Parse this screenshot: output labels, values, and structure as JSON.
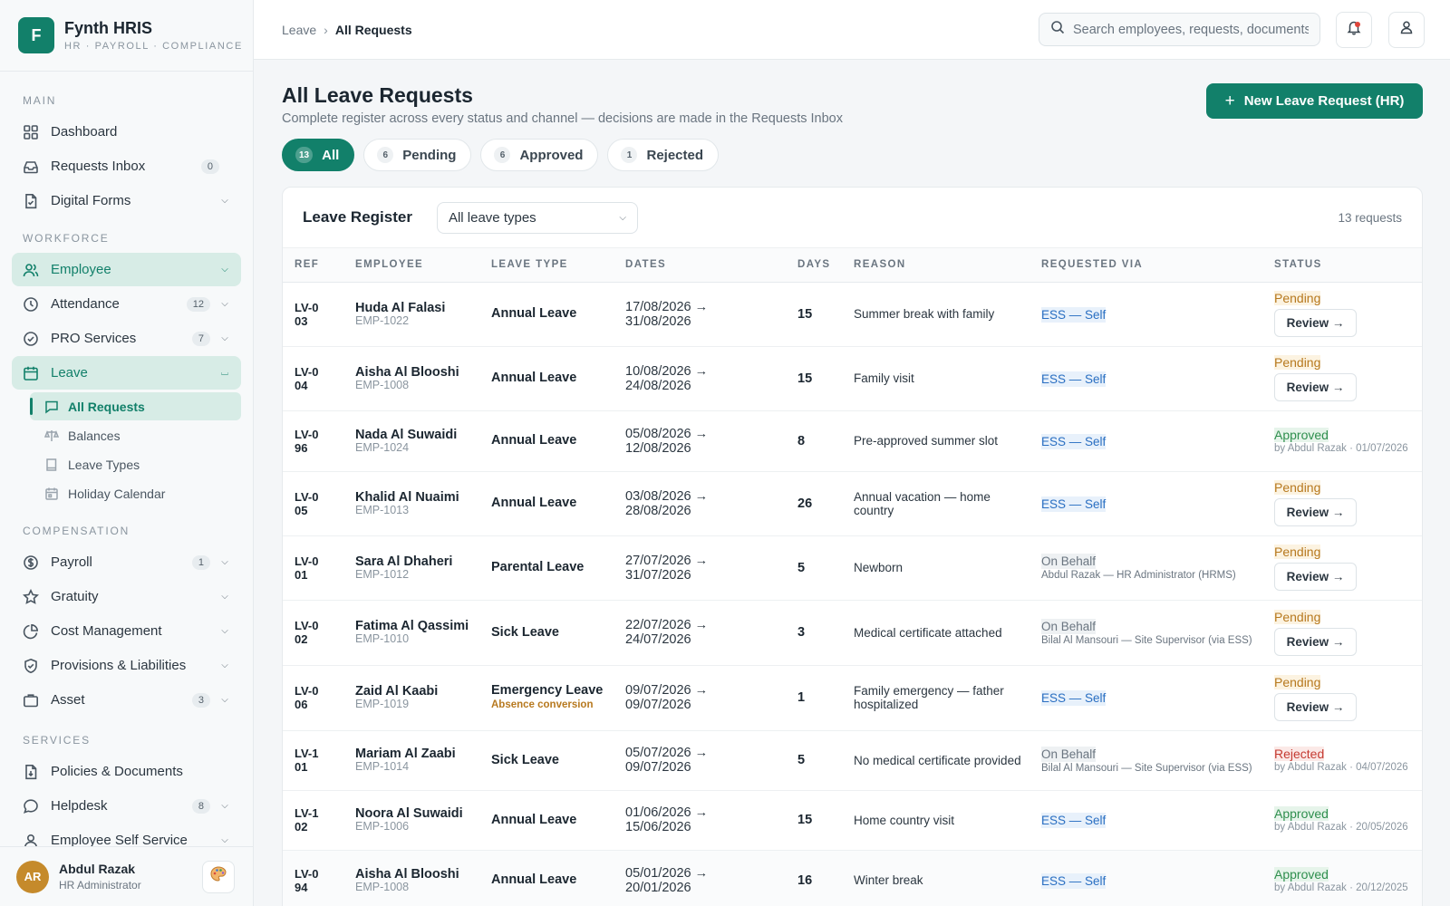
{
  "brand": {
    "logo_letter": "F",
    "name": "Fynth HRIS",
    "subtitle": "HR · PAYROLL · COMPLIANCE",
    "color": "#12806a"
  },
  "sidebar": {
    "sections": {
      "main": "MAIN",
      "workforce": "WORKFORCE",
      "compensation": "COMPENSATION",
      "services": "SERVICES"
    },
    "main_items": [
      {
        "label": "Dashboard",
        "icon": "grid-icon"
      },
      {
        "label": "Requests Inbox",
        "icon": "inbox-icon",
        "badge": "0"
      },
      {
        "label": "Digital Forms",
        "icon": "form-icon"
      }
    ],
    "workforce_items": [
      {
        "label": "Employee",
        "icon": "users-icon",
        "active": true
      },
      {
        "label": "Attendance",
        "icon": "clock-icon",
        "badge": "12"
      },
      {
        "label": "PRO Services",
        "icon": "check-circle-icon",
        "badge": "7"
      },
      {
        "label": "Leave",
        "icon": "calendar-icon",
        "active": true,
        "expanded": true
      }
    ],
    "leave_sub_items": [
      {
        "label": "All Requests",
        "icon": "message-icon",
        "active": true
      },
      {
        "label": "Balances",
        "icon": "scale-icon"
      },
      {
        "label": "Leave Types",
        "icon": "book-icon"
      },
      {
        "label": "Holiday Calendar",
        "icon": "calendar-small-icon"
      }
    ],
    "compensation_items": [
      {
        "label": "Payroll",
        "icon": "dollar-icon",
        "badge": "1"
      },
      {
        "label": "Gratuity",
        "icon": "star-icon"
      },
      {
        "label": "Cost Management",
        "icon": "pie-icon"
      },
      {
        "label": "Provisions & Liabilities",
        "icon": "shield-icon"
      },
      {
        "label": "Asset",
        "icon": "briefcase-icon",
        "badge": "3"
      }
    ],
    "services_items": [
      {
        "label": "Policies & Documents",
        "icon": "document-icon"
      },
      {
        "label": "Helpdesk",
        "icon": "chat-icon",
        "badge": "8"
      },
      {
        "label": "Employee Self Service",
        "icon": "user-icon"
      }
    ]
  },
  "user": {
    "initials": "AR",
    "name": "Abdul Razak",
    "role": "HR Administrator",
    "avatar_color": "#c58a2b"
  },
  "topbar": {
    "breadcrumb": [
      "Leave",
      "All Requests"
    ],
    "search_placeholder": "Search employees, requests, documents..."
  },
  "page": {
    "title": "All Leave Requests",
    "subtitle": "Complete register across every status and channel — decisions are made in the Requests Inbox",
    "new_button": "New Leave Request (HR)"
  },
  "tabs": [
    {
      "count": "13",
      "label": "All",
      "active": true
    },
    {
      "count": "6",
      "label": "Pending"
    },
    {
      "count": "6",
      "label": "Approved"
    },
    {
      "count": "1",
      "label": "Rejected"
    }
  ],
  "register": {
    "title": "Leave Register",
    "filter_value": "All leave types",
    "count_text": "13 requests",
    "columns": [
      "REF",
      "EMPLOYEE",
      "LEAVE TYPE",
      "DATES",
      "DAYS",
      "REASON",
      "REQUESTED VIA",
      "STATUS"
    ],
    "review_label": "Review →",
    "rows": [
      {
        "ref": "LV-003",
        "name": "Huda Al Falasi",
        "emp_id": "EMP-1022",
        "type": "Annual Leave",
        "dates": "17/08/2026 → 31/08/2026",
        "days": "15",
        "reason": "Summer break with family",
        "via": "ESS — Self",
        "via_kind": "self",
        "status": "Pending",
        "status_kind": "pending"
      },
      {
        "ref": "LV-004",
        "name": "Aisha Al Blooshi",
        "emp_id": "EMP-1008",
        "type": "Annual Leave",
        "dates": "10/08/2026 → 24/08/2026",
        "days": "15",
        "reason": "Family visit",
        "via": "ESS — Self",
        "via_kind": "self",
        "status": "Pending",
        "status_kind": "pending"
      },
      {
        "ref": "LV-096",
        "name": "Nada Al Suwaidi",
        "emp_id": "EMP-1024",
        "type": "Annual Leave",
        "dates": "05/08/2026 → 12/08/2026",
        "days": "8",
        "reason": "Pre-approved summer slot",
        "via": "ESS — Self",
        "via_kind": "self",
        "status": "Approved",
        "status_kind": "approved",
        "status_note": "by Abdul Razak · 01/07/2026"
      },
      {
        "ref": "LV-005",
        "name": "Khalid Al Nuaimi",
        "emp_id": "EMP-1013",
        "type": "Annual Leave",
        "dates": "03/08/2026 → 28/08/2026",
        "days": "26",
        "reason": "Annual vacation — home country",
        "via": "ESS — Self",
        "via_kind": "self",
        "status": "Pending",
        "status_kind": "pending"
      },
      {
        "ref": "LV-001",
        "name": "Sara Al Dhaheri",
        "emp_id": "EMP-1012",
        "type": "Parental Leave",
        "dates": "27/07/2026 → 31/07/2026",
        "days": "5",
        "reason": "Newborn",
        "via": "On Behalf",
        "via_kind": "behalf",
        "via_note": "Abdul Razak — HR Administrator (HRMS)",
        "status": "Pending",
        "status_kind": "pending"
      },
      {
        "ref": "LV-002",
        "name": "Fatima Al Qassimi",
        "emp_id": "EMP-1010",
        "type": "Sick Leave",
        "dates": "22/07/2026 → 24/07/2026",
        "days": "3",
        "reason": "Medical certificate attached",
        "via": "On Behalf",
        "via_kind": "behalf",
        "via_note": "Bilal Al Mansouri — Site Supervisor (via ESS)",
        "status": "Pending",
        "status_kind": "pending"
      },
      {
        "ref": "LV-006",
        "name": "Zaid Al Kaabi",
        "emp_id": "EMP-1019",
        "type": "Emergency Leave",
        "type_note": "Absence conversion",
        "dates": "09/07/2026 → 09/07/2026",
        "days": "1",
        "reason": "Family emergency — father hospitalized",
        "via": "ESS — Self",
        "via_kind": "self",
        "status": "Pending",
        "status_kind": "pending"
      },
      {
        "ref": "LV-101",
        "name": "Mariam Al Zaabi",
        "emp_id": "EMP-1014",
        "type": "Sick Leave",
        "dates": "05/07/2026 → 09/07/2026",
        "days": "5",
        "reason": "No medical certificate provided",
        "via": "On Behalf",
        "via_kind": "behalf",
        "via_note": "Bilal Al Mansouri — Site Supervisor (via ESS)",
        "status": "Rejected",
        "status_kind": "rejected",
        "status_note": "by Abdul Razak · 04/07/2026"
      },
      {
        "ref": "LV-102",
        "name": "Noora Al Suwaidi",
        "emp_id": "EMP-1006",
        "type": "Annual Leave",
        "dates": "01/06/2026 → 15/06/2026",
        "days": "15",
        "reason": "Home country visit",
        "via": "ESS — Self",
        "via_kind": "self",
        "status": "Approved",
        "status_kind": "approved",
        "status_note": "by Abdul Razak · 20/05/2026"
      },
      {
        "ref": "LV-094",
        "name": "Aisha Al Blooshi",
        "emp_id": "EMP-1008",
        "type": "Annual Leave",
        "dates": "05/01/2026 → 20/01/2026",
        "days": "16",
        "reason": "Winter break",
        "via": "ESS — Self",
        "via_kind": "self",
        "status": "Approved",
        "status_kind": "approved",
        "status_note": "by Abdul Razak · 20/12/2025"
      }
    ]
  }
}
